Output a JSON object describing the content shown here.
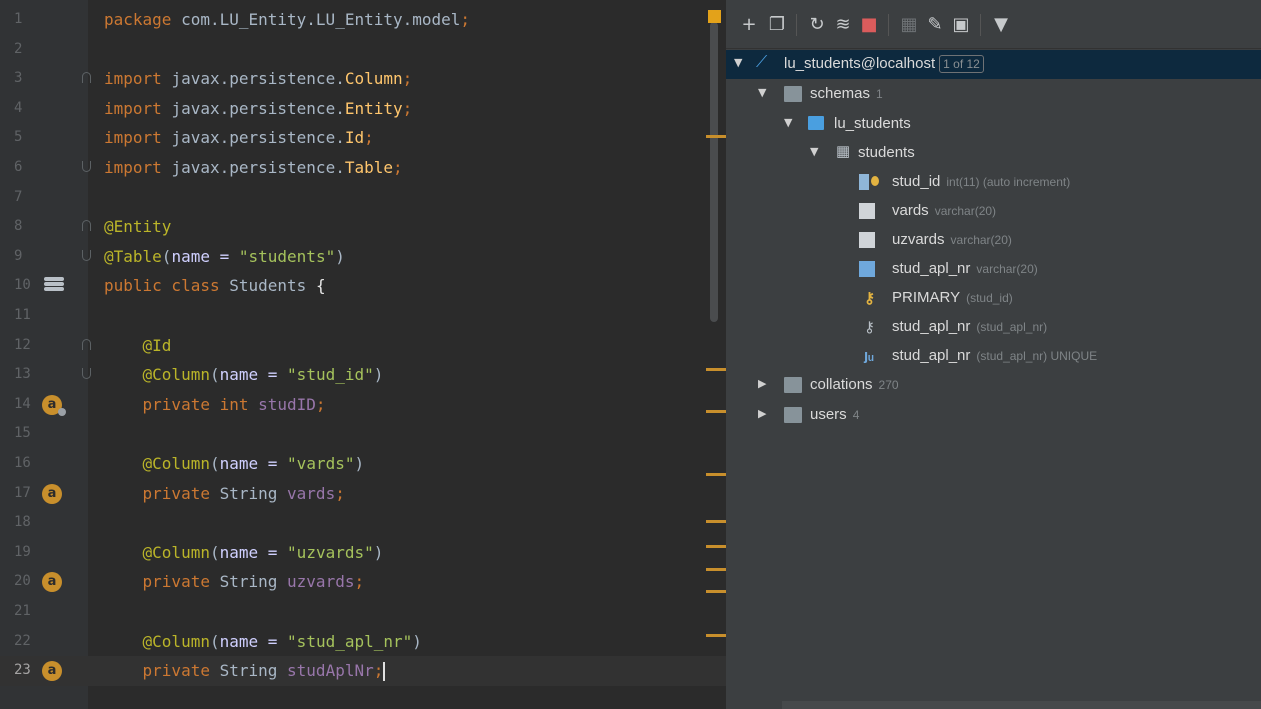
{
  "editor": {
    "lines": [
      {
        "n": "1",
        "tokens": [
          [
            "package com.LU_Entity.LU_Entity.model;",
            "#cc7832|#a9b7c6"
          ]
        ]
      },
      {
        "n": "2",
        "tokens": []
      },
      {
        "n": "3",
        "tokens": [
          [
            "import ",
            "#cc7832"
          ],
          [
            "javax.persistence.",
            "#a9b7c6"
          ],
          [
            "Column",
            "#ffc66d"
          ],
          [
            ";",
            "#cc7832"
          ]
        ]
      },
      {
        "n": "4",
        "tokens": [
          [
            "import ",
            "#cc7832"
          ],
          [
            "javax.persistence.",
            "#a9b7c6"
          ],
          [
            "Entity",
            "#ffc66d"
          ],
          [
            ";",
            "#cc7832"
          ]
        ]
      },
      {
        "n": "5",
        "tokens": [
          [
            "import ",
            "#cc7832"
          ],
          [
            "javax.persistence.",
            "#a9b7c6"
          ],
          [
            "Id",
            "#ffc66d"
          ],
          [
            ";",
            "#cc7832"
          ]
        ]
      },
      {
        "n": "6",
        "tokens": [
          [
            "import ",
            "#cc7832"
          ],
          [
            "javax.persistence.",
            "#a9b7c6"
          ],
          [
            "Table",
            "#ffc66d"
          ],
          [
            ";",
            "#cc7832"
          ]
        ]
      },
      {
        "n": "7",
        "tokens": []
      },
      {
        "n": "8",
        "tokens": [
          [
            "@Entity",
            "#bbb529"
          ]
        ]
      },
      {
        "n": "9",
        "tokens": [
          [
            "@Table",
            "#bbb529"
          ],
          [
            "(",
            "#a9b7c6"
          ],
          [
            "name = ",
            "#d0d0ff"
          ],
          [
            "\"students\"",
            "#a5c25c"
          ],
          [
            ")",
            "#a9b7c6"
          ]
        ]
      },
      {
        "n": "10",
        "tokens": [
          [
            "public class ",
            "#cc7832"
          ],
          [
            "Students ",
            "#a9b7c6"
          ],
          [
            "{",
            "#e8e8e8"
          ]
        ]
      },
      {
        "n": "11",
        "tokens": []
      },
      {
        "n": "12",
        "tokens": [
          [
            "    @Id",
            "#bbb529"
          ]
        ]
      },
      {
        "n": "13",
        "tokens": [
          [
            "    @Column",
            "#bbb529"
          ],
          [
            "(",
            "#a9b7c6"
          ],
          [
            "name = ",
            "#d0d0ff"
          ],
          [
            "\"stud_id\"",
            "#a5c25c"
          ],
          [
            ")",
            "#a9b7c6"
          ]
        ]
      },
      {
        "n": "14",
        "tokens": [
          [
            "    private int ",
            "#cc7832"
          ],
          [
            "studID",
            "#9876aa"
          ],
          [
            ";",
            "#cc7832"
          ]
        ]
      },
      {
        "n": "15",
        "tokens": []
      },
      {
        "n": "16",
        "tokens": [
          [
            "    @Column",
            "#bbb529"
          ],
          [
            "(",
            "#a9b7c6"
          ],
          [
            "name = ",
            "#d0d0ff"
          ],
          [
            "\"vards\"",
            "#a5c25c"
          ],
          [
            ")",
            "#a9b7c6"
          ]
        ]
      },
      {
        "n": "17",
        "tokens": [
          [
            "    private ",
            "#cc7832"
          ],
          [
            "String ",
            "#a9b7c6"
          ],
          [
            "vards",
            "#9876aa"
          ],
          [
            ";",
            "#cc7832"
          ]
        ]
      },
      {
        "n": "18",
        "tokens": []
      },
      {
        "n": "19",
        "tokens": [
          [
            "    @Column",
            "#bbb529"
          ],
          [
            "(",
            "#a9b7c6"
          ],
          [
            "name = ",
            "#d0d0ff"
          ],
          [
            "\"uzvards\"",
            "#a5c25c"
          ],
          [
            ")",
            "#a9b7c6"
          ]
        ]
      },
      {
        "n": "20",
        "tokens": [
          [
            "    private ",
            "#cc7832"
          ],
          [
            "String ",
            "#a9b7c6"
          ],
          [
            "uzvards",
            "#9876aa"
          ],
          [
            ";",
            "#cc7832"
          ]
        ]
      },
      {
        "n": "21",
        "tokens": []
      },
      {
        "n": "22",
        "tokens": [
          [
            "    @Column",
            "#bbb529"
          ],
          [
            "(",
            "#a9b7c6"
          ],
          [
            "name = ",
            "#d0d0ff"
          ],
          [
            "\"stud_apl_nr\"",
            "#a5c25c"
          ],
          [
            ")",
            "#a9b7c6"
          ]
        ]
      },
      {
        "n": "23",
        "tokens": [
          [
            "    private ",
            "#cc7832"
          ],
          [
            "String ",
            "#a9b7c6"
          ],
          [
            "studAplNr",
            "#9876aa"
          ],
          [
            ";",
            "#cc7832"
          ]
        ]
      }
    ],
    "gutter_badges": {
      "14": "a",
      "17": "a",
      "20": "a",
      "23": "a"
    }
  },
  "db": {
    "toolbar_icons": [
      "add-icon",
      "duplicate-icon",
      "refresh-icon",
      "sync-icon",
      "stop-icon",
      "table-icon",
      "edit-icon",
      "console-icon",
      "filter-icon"
    ],
    "tree": {
      "root": {
        "label": "lu_students@localhost",
        "badge": "1 of 12"
      },
      "schemas": {
        "label": "schemas",
        "count": "1"
      },
      "schema": {
        "label": "lu_students"
      },
      "table": {
        "label": "students"
      },
      "columns": [
        {
          "label": "stud_id",
          "hint": "int(11) (auto increment)"
        },
        {
          "label": "vards",
          "hint": "varchar(20)"
        },
        {
          "label": "uzvards",
          "hint": "varchar(20)"
        },
        {
          "label": "stud_apl_nr",
          "hint": "varchar(20)"
        }
      ],
      "keys": [
        {
          "label": "PRIMARY",
          "hint": "(stud_id)"
        },
        {
          "label": "stud_apl_nr",
          "hint": "(stud_apl_nr)"
        },
        {
          "label": "stud_apl_nr",
          "hint": "(stud_apl_nr) UNIQUE"
        }
      ],
      "collations": {
        "label": "collations",
        "count": "270"
      },
      "users": {
        "label": "users",
        "count": "4"
      }
    },
    "colors": {
      "selected": "#0d293e",
      "keyword": "#cc7832",
      "annotation": "#bbb529",
      "string": "#a5c25c",
      "field": "#9876aa"
    }
  }
}
